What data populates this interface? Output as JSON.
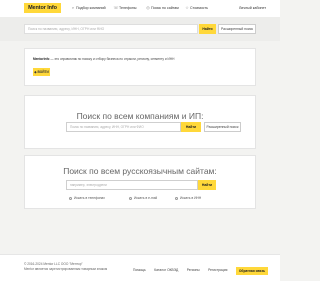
{
  "header": {
    "logo": "Mentor Info",
    "nav": [
      {
        "icon": "search-icon",
        "label": "Подбор компаний"
      },
      {
        "icon": "phone-icon",
        "label": "Телефоны"
      },
      {
        "icon": "globe-icon",
        "label": "Поиск по сайтам"
      },
      {
        "icon": "star-icon",
        "label": "Стоимость"
      }
    ],
    "cabinet": "Личный кабинет"
  },
  "top_search": {
    "placeholder": "Поиск по названию, адресу, ИНН, ОГРН или ФИО",
    "button": "Найти",
    "advanced": "Расширенный поиск"
  },
  "info": {
    "bold": "MentorInfo",
    "text": "— это справочник по поиску и отбору бизнеса по отрасли, региону, сегменту и ИНН",
    "button": "ВОЙТИ"
  },
  "companies": {
    "title": "Поиск по всем компаниям и ИП:",
    "placeholder": "Поиск по названию, адресу, ИНН, ОГРН или ФИО",
    "button": "Найти",
    "advanced": "Расширенный поиск"
  },
  "sites": {
    "title": "Поиск по всем русскоязычным сайтам:",
    "placeholder": "например, электродрели",
    "button": "Найти",
    "options": [
      "Искать в телефонах",
      "Искать в e-mail",
      "Искать в ИНН"
    ]
  },
  "footer": {
    "line1": "© 2016-2024 Mentor LLC ООО \"Ментор\"",
    "line2": "Mentor является зарегистрированным товарным знаком",
    "links": [
      "Помощь",
      "Каталог ОКВЭД",
      "Регионы",
      "Регистрация"
    ],
    "button": "Обратная связь"
  }
}
